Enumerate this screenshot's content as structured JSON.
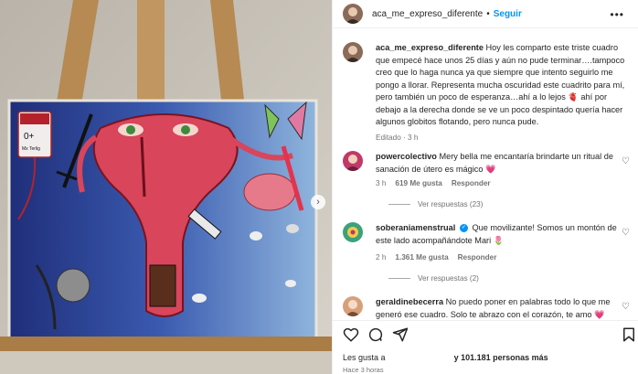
{
  "post": {
    "username": "aca_me_expreso_diferente",
    "follow_label": "Seguir",
    "more_label": "•••",
    "caption_username": "aca_me_expreso_diferente",
    "caption_text": "Hoy les comparto este triste cuadro que empecé hace unos 25 días y aún no pude terminar….tampoco creo que lo haga nunca ya que siempre que intento seguirlo me pongo a llorar. Representa mucha oscuridad este cuadrito para mí, pero también un poco de esperanza…ahí a lo lejos 🫀 ahí por debajo a la derecha donde se ve un poco despintado quería hacer algunos globitos flotando, pero nunca pude.",
    "caption_meta": "Editado · 3 h",
    "painting_labels": {
      "blood_bag": "0+",
      "blood_bag_small": "Mx Terlig"
    }
  },
  "comments": [
    {
      "username": "powercolectivo",
      "text": "Mery bella me encantaría brindarte un ritual de sanación de útero es mágico 💗",
      "time": "3 h",
      "likes": "619 Me gusta",
      "reply": "Responder",
      "replies": "Ver respuestas (23)"
    },
    {
      "username": "soberaniamenstrual",
      "text": "Que movilizante! Somos un montón de este lado acompañándote Mari 🌷",
      "time": "2 h",
      "likes": "1.361 Me gusta",
      "reply": "Responder",
      "replies": "Ver respuestas (2)"
    },
    {
      "username": "geraldinebecerra",
      "text": "No puedo poner en palabras todo lo que me generó ese cuadro. Solo te abrazo con el corazón, te amo 💗"
    }
  ],
  "footer": {
    "likes_prefix": "Les gusta a",
    "likes_count": "y 101.181 personas más",
    "time_ago": "Hace 3 horas"
  },
  "icons": {
    "verified": "✓",
    "next": "›",
    "heart": "♡"
  },
  "colors": {
    "follow": "#0095f6",
    "meta": "#737373",
    "canvas_blue": "#3b5bb0",
    "uterus_red": "#d9455a"
  }
}
